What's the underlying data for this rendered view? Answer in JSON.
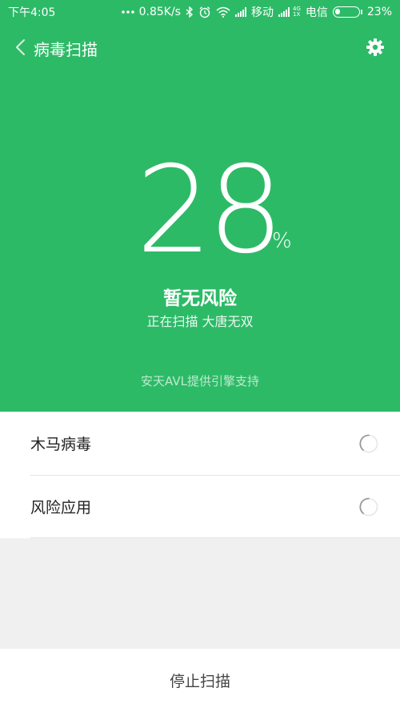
{
  "status_bar": {
    "time": "下午4:05",
    "speed": "0.85K/s",
    "carrier1": "移动",
    "carrier2": "电信",
    "network_top": "4G",
    "network_bottom": "1X",
    "battery": "23%",
    "battery_level": 0.23
  },
  "toolbar": {
    "title": "病毒扫描"
  },
  "scan": {
    "percent": "28",
    "percent_unit": "%",
    "risk_status": "暂无风险",
    "current_target": "正在扫描 大唐无双",
    "engine_credit": "安天AVL提供引擎支持"
  },
  "results": {
    "items": [
      {
        "label": "木马病毒"
      },
      {
        "label": "风险应用"
      }
    ]
  },
  "footer": {
    "stop_label": "停止扫描"
  },
  "colors": {
    "accent": "#2dba67",
    "white": "#ffffff"
  }
}
